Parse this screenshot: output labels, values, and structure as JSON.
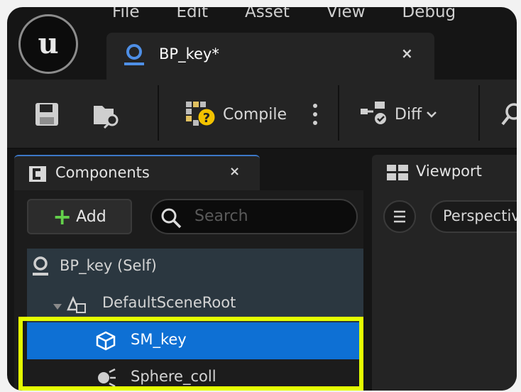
{
  "menu": [
    "File",
    "Edit",
    "Asset",
    "View",
    "Debug"
  ],
  "tab": {
    "title": "BP_key*",
    "close": "×"
  },
  "toolbar": {
    "compile_label": "Compile",
    "diff_label": "Diff"
  },
  "components": {
    "title": "Components",
    "close": "×",
    "add_label": "Add",
    "search_placeholder": "Search",
    "tree": [
      {
        "label": "BP_key (Self)",
        "icon": "blueprint-self-icon"
      },
      {
        "label": "DefaultSceneRoot",
        "icon": "scene-root-icon"
      },
      {
        "label": "SM_key",
        "icon": "static-mesh-icon",
        "selected": true
      },
      {
        "label": "Sphere_coll",
        "icon": "sphere-collision-icon"
      }
    ]
  },
  "viewport": {
    "title": "Viewport",
    "mode": "Perspective"
  },
  "colors": {
    "selection": "#0e70d4",
    "highlight": "#e5ff00",
    "accent_green": "#64d14b"
  }
}
